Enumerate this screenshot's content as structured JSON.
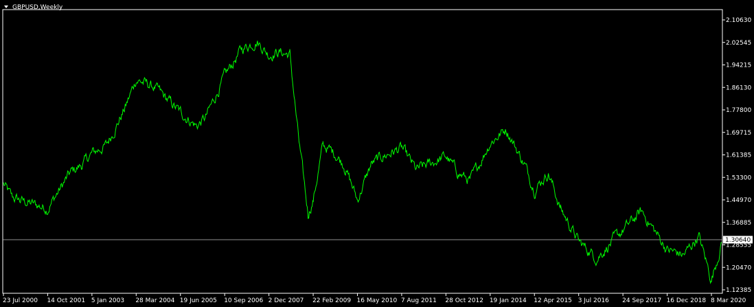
{
  "chart_data": {
    "type": "line",
    "title": "GBPUSD,Weekly",
    "series": [
      {
        "x": [
          "23 Jul 2000",
          "15 Oct 2000",
          "4 Jan 2001",
          "14 Oct 2001",
          "1 Jun 2002",
          "1 Oct 2002",
          "5 Jan 2003",
          "1 Jun 2003",
          "1 Dec 2003",
          "28 Mar 2004",
          "1 Oct 2004",
          "19 Jun 2005",
          "1 Dec 2005",
          "1 Mar 2006",
          "10 Sep 2006",
          "1 Mar 2007",
          "1 Aug 2007",
          "2 Dec 2007",
          "1 Mar 2008",
          "1 Jul 2008",
          "1 Oct 2008",
          "1 Jan 2009",
          "22 Feb 2009",
          "1 Jun 2009",
          "1 Oct 2009",
          "1 Jan 2010",
          "16 May 2010",
          "1 Oct 2010",
          "1 Feb 2011",
          "7 Aug 2011",
          "1 Jan 2012",
          "1 May 2012",
          "28 Oct 2012",
          "1 Mar 2013",
          "1 Jul 2013",
          "19 Jan 2014",
          "1 Jul 2014",
          "1 Jan 2015",
          "12 Apr 2015",
          "1 Sep 2015",
          "1 Jan 2016",
          "3 Jul 2016",
          "1 Jan 2017",
          "24 Sep 2017",
          "1 Apr 2018",
          "16 Dec 2018",
          "1 Jun 2019",
          "1 Nov 2019",
          "8 Mar 2020",
          "1 Jul 2020"
        ],
        "values": [
          1.51,
          1.46,
          1.45,
          1.42,
          1.55,
          1.58,
          1.62,
          1.65,
          1.78,
          1.89,
          1.86,
          1.77,
          1.72,
          1.75,
          1.9,
          2.0,
          2.03,
          1.98,
          1.99,
          1.98,
          1.66,
          1.4,
          1.45,
          1.65,
          1.62,
          1.58,
          1.45,
          1.58,
          1.61,
          1.64,
          1.56,
          1.58,
          1.61,
          1.55,
          1.52,
          1.66,
          1.71,
          1.58,
          1.49,
          1.55,
          1.42,
          1.3,
          1.24,
          1.34,
          1.41,
          1.27,
          1.25,
          1.32,
          1.16,
          1.31
        ],
        "color": "#00ff00"
      }
    ],
    "x_tick_labels": [
      "23 Jul 2000",
      "14 Oct 2001",
      "5 Jan 2003",
      "28 Mar 2004",
      "19 Jun 2005",
      "10 Sep 2006",
      "2 Dec 2007",
      "22 Feb 2009",
      "16 May 2010",
      "7 Aug 2011",
      "28 Oct 2012",
      "19 Jan 2014",
      "12 Apr 2015",
      "3 Jul 2016",
      "24 Sep 2017",
      "16 Dec 2018",
      "8 Mar 2020"
    ],
    "y_tick_labels": [
      "2.10630",
      "2.02545",
      "1.94215",
      "1.86130",
      "1.77800",
      "1.69715",
      "1.61385",
      "1.53300",
      "1.44970",
      "1.36885",
      "1.28555",
      "1.20470",
      "1.12385"
    ],
    "ylim": [
      1.12385,
      2.1063
    ],
    "current_price": "1.30640",
    "current_price_value": 1.3064,
    "grid": false,
    "colors": {
      "background": "#000000",
      "line": "#00ff00",
      "axis": "#ffffff",
      "price_line": "#c0c0c0"
    }
  }
}
